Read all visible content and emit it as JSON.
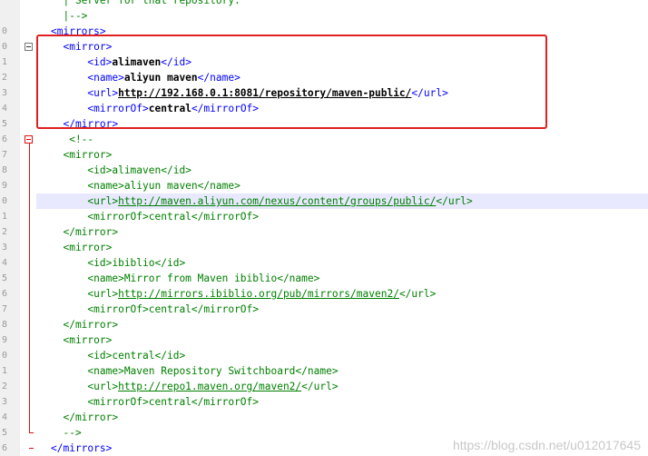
{
  "editor": {
    "lines": [
      {
        "ln": "",
        "fold": "",
        "segments": [
          {
            "t": "c",
            "s": "  | Server for that repository."
          }
        ]
      },
      {
        "ln": "",
        "fold": "",
        "segments": [
          {
            "t": "c",
            "s": "  |-->"
          }
        ]
      },
      {
        "ln": "0",
        "fold": "",
        "segments": [
          {
            "t": "g",
            "s": "<mirrors>"
          }
        ]
      },
      {
        "ln": "0",
        "fold": "box",
        "segments": [
          {
            "t": "g",
            "s": "  <mirror>"
          }
        ]
      },
      {
        "ln": "1",
        "fold": "",
        "segments": [
          {
            "t": "g",
            "s": "      <id>"
          },
          {
            "t": "b",
            "s": "alimaven"
          },
          {
            "t": "g",
            "s": "</id>"
          }
        ]
      },
      {
        "ln": "2",
        "fold": "",
        "segments": [
          {
            "t": "g",
            "s": "      <name>"
          },
          {
            "t": "b",
            "s": "aliyun maven"
          },
          {
            "t": "g",
            "s": "</name>"
          }
        ]
      },
      {
        "ln": "3",
        "fold": "",
        "segments": [
          {
            "t": "g",
            "s": "      <url>"
          },
          {
            "t": "ub",
            "s": "http://192.168.0.1:8081/repository/maven-public/"
          },
          {
            "t": "g",
            "s": "</url>"
          }
        ]
      },
      {
        "ln": "4",
        "fold": "",
        "segments": [
          {
            "t": "g",
            "s": "      <mirrorOf>"
          },
          {
            "t": "b",
            "s": "central"
          },
          {
            "t": "g",
            "s": "</mirrorOf>"
          }
        ]
      },
      {
        "ln": "5",
        "fold": "",
        "segments": [
          {
            "t": "g",
            "s": "  </mirror>"
          }
        ]
      },
      {
        "ln": "6",
        "fold": "redbox",
        "segments": [
          {
            "t": "c",
            "s": "   <!--"
          }
        ]
      },
      {
        "ln": "7",
        "fold": "",
        "segments": [
          {
            "t": "c",
            "s": "  <mirror>"
          }
        ]
      },
      {
        "ln": "8",
        "fold": "",
        "segments": [
          {
            "t": "c",
            "s": "      <id>alimaven</id>"
          }
        ]
      },
      {
        "ln": "9",
        "fold": "",
        "segments": [
          {
            "t": "c",
            "s": "      <name>aliyun maven</name>"
          }
        ]
      },
      {
        "ln": "0",
        "fold": "",
        "hl": true,
        "segments": [
          {
            "t": "c",
            "s": "      <url>"
          },
          {
            "t": "uc",
            "s": "http://maven.aliyun.com/nexus/content/groups/public/"
          },
          {
            "t": "c",
            "s": "</url>"
          }
        ]
      },
      {
        "ln": "1",
        "fold": "",
        "segments": [
          {
            "t": "c",
            "s": "      <mirrorOf>central</mirrorOf>"
          }
        ]
      },
      {
        "ln": "2",
        "fold": "",
        "segments": [
          {
            "t": "c",
            "s": "  </mirror>"
          }
        ]
      },
      {
        "ln": "3",
        "fold": "",
        "segments": [
          {
            "t": "c",
            "s": "  <mirror>"
          }
        ]
      },
      {
        "ln": "4",
        "fold": "",
        "segments": [
          {
            "t": "c",
            "s": "      <id>ibiblio</id>"
          }
        ]
      },
      {
        "ln": "5",
        "fold": "",
        "segments": [
          {
            "t": "c",
            "s": "      <name>Mirror from Maven ibiblio</name>"
          }
        ]
      },
      {
        "ln": "6",
        "fold": "",
        "segments": [
          {
            "t": "c",
            "s": "      <url>"
          },
          {
            "t": "uc",
            "s": "http://mirrors.ibiblio.org/pub/mirrors/maven2/"
          },
          {
            "t": "c",
            "s": "</url>"
          }
        ]
      },
      {
        "ln": "7",
        "fold": "",
        "segments": [
          {
            "t": "c",
            "s": "      <mirrorOf>central</mirrorOf>"
          }
        ]
      },
      {
        "ln": "8",
        "fold": "",
        "segments": [
          {
            "t": "c",
            "s": "  </mirror>"
          }
        ]
      },
      {
        "ln": "9",
        "fold": "",
        "segments": [
          {
            "t": "c",
            "s": "  <mirror>"
          }
        ]
      },
      {
        "ln": "0",
        "fold": "",
        "segments": [
          {
            "t": "c",
            "s": "      <id>central</id>"
          }
        ]
      },
      {
        "ln": "1",
        "fold": "",
        "segments": [
          {
            "t": "c",
            "s": "      <name>Maven Repository Switchboard</name>"
          }
        ]
      },
      {
        "ln": "2",
        "fold": "",
        "segments": [
          {
            "t": "c",
            "s": "      <url>"
          },
          {
            "t": "uc",
            "s": "http://repo1.maven.org/maven2/"
          },
          {
            "t": "c",
            "s": "</url>"
          }
        ]
      },
      {
        "ln": "3",
        "fold": "",
        "segments": [
          {
            "t": "c",
            "s": "      <mirrorOf>central</mirrorOf>"
          }
        ]
      },
      {
        "ln": "4",
        "fold": "",
        "segments": [
          {
            "t": "c",
            "s": "  </mirror>"
          }
        ]
      },
      {
        "ln": "5",
        "fold": "",
        "segments": [
          {
            "t": "c",
            "s": "  -->"
          }
        ]
      },
      {
        "ln": "6",
        "fold": "",
        "segments": [
          {
            "t": "g",
            "s": "</mirrors>"
          }
        ]
      }
    ]
  },
  "watermark": "https://blog.csdn.net/u012017645",
  "colors": {
    "tag": "#0000ff",
    "comment": "#008000",
    "highlight_box": "#e02020",
    "fold_line": "#dd1111"
  }
}
